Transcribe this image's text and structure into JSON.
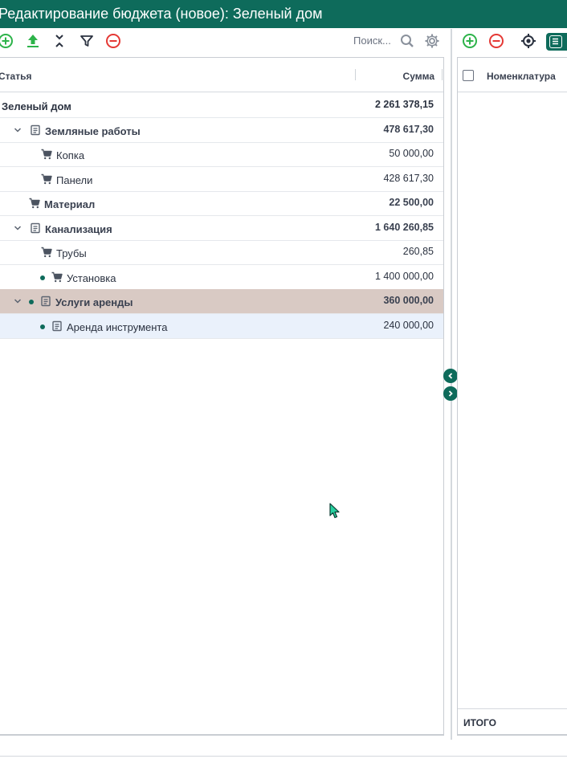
{
  "window": {
    "title": "Редактирование бюджета (новое): Зеленый дом"
  },
  "toolbar_left": {
    "search_placeholder": "Поиск...",
    "icons": [
      "add-icon",
      "upload-icon",
      "collapse-icon",
      "filter-icon",
      "remove-icon",
      "search-icon",
      "gear-icon"
    ]
  },
  "tree": {
    "columns": {
      "article": "Статья",
      "sum": "Сумма"
    },
    "rows": [
      {
        "label": "Зеленый дом",
        "value": "2 261 378,15",
        "level": 0,
        "icon": "none",
        "expand": false,
        "dot": false
      },
      {
        "label": "Земляные работы",
        "value": "478 617,30",
        "level": 1,
        "icon": "doc-icon",
        "expand": true,
        "dot": false
      },
      {
        "label": "Копка",
        "value": "50 000,00",
        "level": 2,
        "icon": "cart-icon",
        "expand": false,
        "dot": false
      },
      {
        "label": "Панели",
        "value": "428 617,30",
        "level": 2,
        "icon": "cart-icon",
        "expand": false,
        "dot": false
      },
      {
        "label": "Материал",
        "value": "22 500,00",
        "level": 1,
        "icon": "cart-icon",
        "expand": false,
        "dot": false
      },
      {
        "label": "Канализация",
        "value": "1 640 260,85",
        "level": 1,
        "icon": "doc-icon",
        "expand": true,
        "dot": false
      },
      {
        "label": "Трубы",
        "value": "260,85",
        "level": 2,
        "icon": "cart-icon",
        "expand": false,
        "dot": false
      },
      {
        "label": "Установка",
        "value": "1 400 000,00",
        "level": 2,
        "icon": "cart-icon",
        "expand": false,
        "dot": true
      },
      {
        "label": "Услуги аренды",
        "value": "360 000,00",
        "level": 1,
        "icon": "doc-icon",
        "expand": true,
        "dot": true,
        "selected": true
      },
      {
        "label": "Аренда инструмента",
        "value": "240 000,00",
        "level": 2,
        "icon": "doc-icon",
        "expand": false,
        "dot": true,
        "hover": true
      }
    ]
  },
  "right_panel": {
    "column_nomenclature": "Номенклатура",
    "footer_total": "ИТОГО"
  },
  "colors": {
    "brand": "#0e6b5b",
    "add_green": "#2db34a",
    "remove_red": "#e53935",
    "selected_row": "#d9cac4",
    "hover_row": "#eaf1fb"
  }
}
